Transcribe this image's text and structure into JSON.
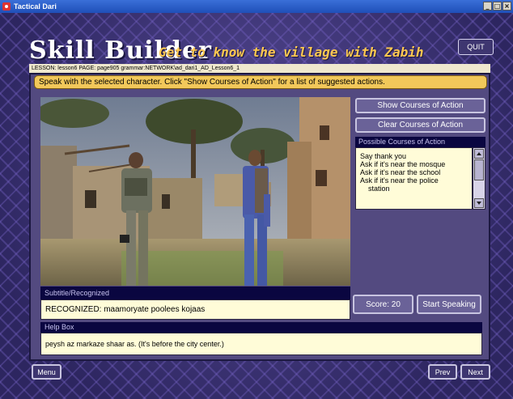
{
  "window": {
    "title": "Tactical Dari",
    "minimize": "_",
    "maximize": "□",
    "close": "×"
  },
  "header": {
    "title": "Skill Builder",
    "subtitle": "Get to know the village with Zabih",
    "quit_label": "QUIT"
  },
  "lesson_info": "LESSON: lesson6 PAGE: page905 grammar:NETWORK\\ad_dari1_AD_Lesson6_1",
  "instruction": "Speak with the selected character.  Click \"Show Courses of Action\" for a list of suggested actions.",
  "courses": {
    "show_label": "Show Courses of Action",
    "clear_label": "Clear Courses of Action",
    "header": "Possible Courses of Action",
    "items": [
      "Say thank you",
      "Ask if it's near the mosque",
      "Ask if it's near the school",
      "Ask if it's near the police",
      "station"
    ]
  },
  "subtitle_panel": {
    "header": "Subtitle/Recognized",
    "text": "RECOGNIZED: maamoryate poolees kojaas"
  },
  "score": {
    "label": "Score: 20"
  },
  "speak": {
    "label": "Start Speaking"
  },
  "help": {
    "header": "Help Box",
    "text": "peysh az markaze shaar as. (It's before the city center.)"
  },
  "nav": {
    "menu_label": "Menu",
    "prev_label": "Prev",
    "next_label": "Next"
  },
  "colors": {
    "frame": "#2d2660",
    "panel": "#534a80",
    "instruction_bg": "#f2c85a",
    "subtitle_color": "#ffc850",
    "header_bar": "#0a0640",
    "text_box": "#fffcd8"
  }
}
